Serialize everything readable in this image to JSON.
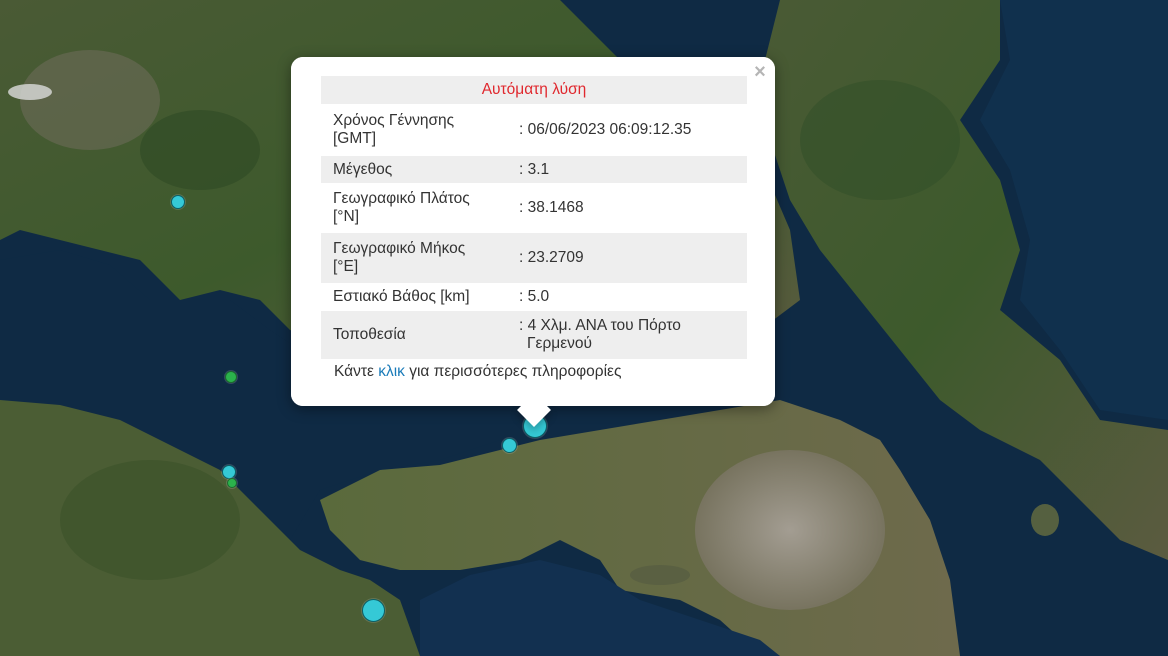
{
  "popup": {
    "title": "Αυτόματη λύση",
    "close_symbol": "×",
    "rows": [
      {
        "label_line1": "Χρόνος Γέννησης",
        "label_line2": "[GMT]",
        "value_line1": ": 06/06/2023 06:09:12.35",
        "value_line2": ""
      },
      {
        "label_line1": "Μέγεθος",
        "label_line2": "",
        "value_line1": ": 3.1",
        "value_line2": ""
      },
      {
        "label_line1": "Γεωγραφικό Πλάτος",
        "label_line2": "[°N]",
        "value_line1": ": 38.1468",
        "value_line2": ""
      },
      {
        "label_line1": "Γεωγραφικό Μήκος",
        "label_line2": "[°E]",
        "value_line1": ": 23.2709",
        "value_line2": ""
      },
      {
        "label_line1": "Εστιακό Βάθος [km]",
        "label_line2": "",
        "value_line1": ": 5.0",
        "value_line2": ""
      },
      {
        "label_line1": "Τοποθεσία",
        "label_line2": "",
        "value_line1": ": 4 Χλμ. ΑΝΑ του Πόρτο",
        "value_line2": "Γερμενού"
      }
    ],
    "footer_prefix": "Κάντε ",
    "footer_link": "κλικ",
    "footer_suffix": " για περισσότερες πληροφορίες"
  },
  "colors": {
    "sea": "#0f2a44",
    "land_dark": "#3b5a2e",
    "land_light": "#7a7560",
    "urban": "#9a948a",
    "marker_cyan": "#35c9d6",
    "marker_green": "#2bb24c",
    "title_red": "#e0282e",
    "link_blue": "#1a7bb9"
  },
  "icons": {
    "close": "close-icon"
  }
}
